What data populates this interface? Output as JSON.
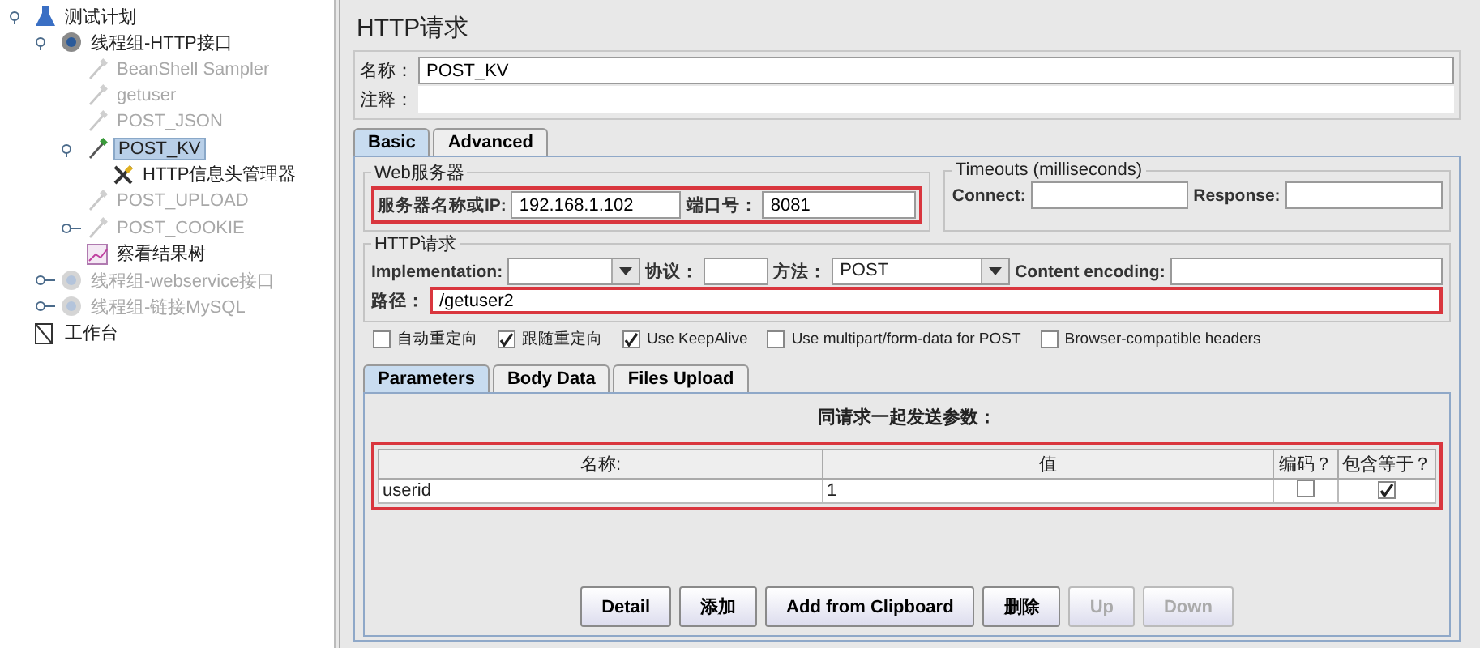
{
  "tree": [
    {
      "label": "测试计划",
      "kind": "plan",
      "disabled": false,
      "selected": false,
      "expanded": true,
      "children": [
        {
          "label": "线程组-HTTP接口",
          "kind": "threadgroup",
          "disabled": false,
          "selected": false,
          "expanded": true,
          "children": [
            {
              "label": "BeanShell Sampler",
              "kind": "sampler",
              "disabled": true,
              "selected": false
            },
            {
              "label": "getuser",
              "kind": "sampler",
              "disabled": true,
              "selected": false
            },
            {
              "label": "POST_JSON",
              "kind": "sampler",
              "disabled": true,
              "selected": false
            },
            {
              "label": "POST_KV",
              "kind": "sampler",
              "disabled": false,
              "selected": true,
              "expanded": true,
              "children": [
                {
                  "label": "HTTP信息头管理器",
                  "kind": "config",
                  "disabled": false,
                  "selected": false
                }
              ]
            },
            {
              "label": "POST_UPLOAD",
              "kind": "sampler",
              "disabled": true,
              "selected": false
            },
            {
              "label": "POST_COOKIE",
              "kind": "sampler",
              "disabled": true,
              "selected": false,
              "expanded": false
            },
            {
              "label": "察看结果树",
              "kind": "listener",
              "disabled": false,
              "selected": false
            }
          ]
        },
        {
          "label": "线程组-webservice接口",
          "kind": "threadgroup",
          "disabled": true,
          "selected": false,
          "expanded": false
        },
        {
          "label": "线程组-链接MySQL",
          "kind": "threadgroup",
          "disabled": true,
          "selected": false,
          "expanded": false
        }
      ]
    },
    {
      "label": "工作台",
      "kind": "workbench",
      "disabled": false,
      "selected": false
    }
  ],
  "panel": {
    "title": "HTTP请求",
    "name_label": "名称：",
    "name_value": "POST_KV",
    "comment_label": "注释："
  },
  "tabs": [
    {
      "label": "Basic",
      "selected": true
    },
    {
      "label": "Advanced",
      "selected": false
    }
  ],
  "web_server": {
    "legend": "Web服务器",
    "server_label": "服务器名称或IP:",
    "server_value": "192.168.1.102",
    "port_label": "端口号：",
    "port_value": "8081",
    "highlighted": true
  },
  "timeouts": {
    "legend": "Timeouts (milliseconds)",
    "connect_label": "Connect:",
    "response_label": "Response:"
  },
  "http_request": {
    "legend": "HTTP请求",
    "implementation_label": "Implementation:",
    "protocol_label": "协议：",
    "method_label": "方法：",
    "method_value": "POST",
    "encoding_label": "Content encoding:",
    "path_label": "路径：",
    "path_value": "/getuser2",
    "path_highlighted": true
  },
  "options": [
    {
      "label": "自动重定向",
      "checked": false
    },
    {
      "label": "跟随重定向",
      "checked": true
    },
    {
      "label": "Use KeepAlive",
      "checked": true
    },
    {
      "label": "Use multipart/form-data for POST",
      "checked": false
    },
    {
      "label": "Browser-compatible headers",
      "checked": false
    }
  ],
  "param_tabs": [
    {
      "label": "Parameters",
      "selected": true
    },
    {
      "label": "Body Data",
      "selected": false
    },
    {
      "label": "Files Upload",
      "selected": false
    }
  ],
  "params": {
    "caption": "同请求一起发送参数：",
    "highlighted": true,
    "columns": [
      "名称:",
      "值",
      "编码？",
      "包含等于？"
    ],
    "rows": [
      {
        "name": "userid",
        "value": "1",
        "encode": false,
        "include_equals": true
      }
    ]
  },
  "buttons": [
    {
      "label": "Detail",
      "disabled": false
    },
    {
      "label": "添加",
      "disabled": false
    },
    {
      "label": "Add from Clipboard",
      "disabled": false
    },
    {
      "label": "删除",
      "disabled": false
    },
    {
      "label": "Up",
      "disabled": true
    },
    {
      "label": "Down",
      "disabled": true
    }
  ]
}
